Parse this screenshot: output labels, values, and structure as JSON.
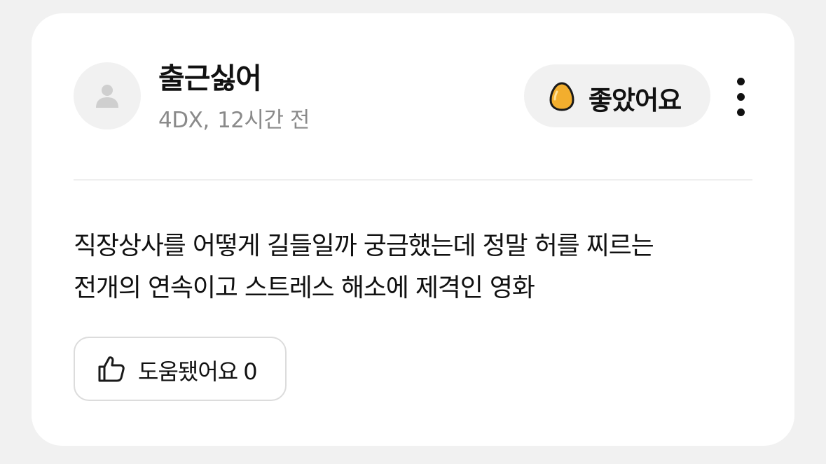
{
  "review": {
    "author": "출근싫어",
    "format": "4DX",
    "time_ago": "12시간 전",
    "avatar_icon": "user-icon",
    "rating": {
      "icon": "egg-icon",
      "label": "좋았어요",
      "color": "#F2AE2E"
    },
    "more_icon": "more-vertical-icon",
    "body_lines": [
      "직장상사를 어떻게 길들일까 궁금했는데 정말 허를 찌르는",
      "전개의 연속이고 스트레스 해소에 제격인 영화"
    ],
    "helpful": {
      "icon": "thumbs-up-icon",
      "label": "도움됐어요",
      "count": "0"
    }
  }
}
